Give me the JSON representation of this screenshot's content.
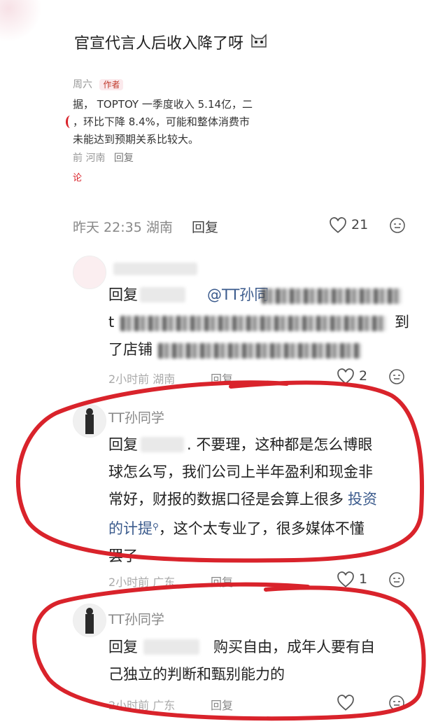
{
  "post": {
    "title": "官宣代言人后收入降了呀",
    "nested_reply": {
      "author": "周六",
      "author_tag": "作者",
      "line1": "据， TOPTOY 一季度收入 5.14亿，二",
      "line2": "，环比下降 8.4%，可能和整体消费市",
      "line3": "未能达到预期关系比较大。",
      "meta_time": "前 河南",
      "meta_reply": "回复",
      "more": "论"
    },
    "footer": {
      "time": "昨天 22:35 湖南",
      "reply": "回复",
      "likes": "21"
    }
  },
  "comments": [
    {
      "line1_prefix": "回复",
      "line1_mention": "@TT孙同",
      "line2_start": "t",
      "line2_end": "到",
      "line3_start": "了店铺",
      "meta_time": "2小时前 湖南",
      "meta_reply": "回复",
      "likes": "2"
    },
    {
      "name": "TT孙同学",
      "line1_prefix": "回复",
      "line1_rest": ". 不要理，这种都是怎么博眼",
      "line2": "球怎么写，我们公司上半年盈利和现金非",
      "line3_a": "常好，财报的数据口径是会算上很多",
      "line3_link": "投资",
      "line4_link": "的计提",
      "line4_rest": "，这个太专业了，很多媒体不懂",
      "line5": "罢了",
      "meta_time": "2小时前 广东",
      "meta_reply": "回复",
      "likes": "1"
    },
    {
      "name": "TT孙同学",
      "line1_prefix": "回复",
      "line1_rest": "购买自由，成年人要有自",
      "line2": "己独立的判断和甄别能力的",
      "meta_time": "2小时前 广东",
      "meta_reply": "回复"
    }
  ],
  "colors": {
    "annotation": "#d9232b",
    "link": "#3a5a8c",
    "muted": "#999999"
  }
}
